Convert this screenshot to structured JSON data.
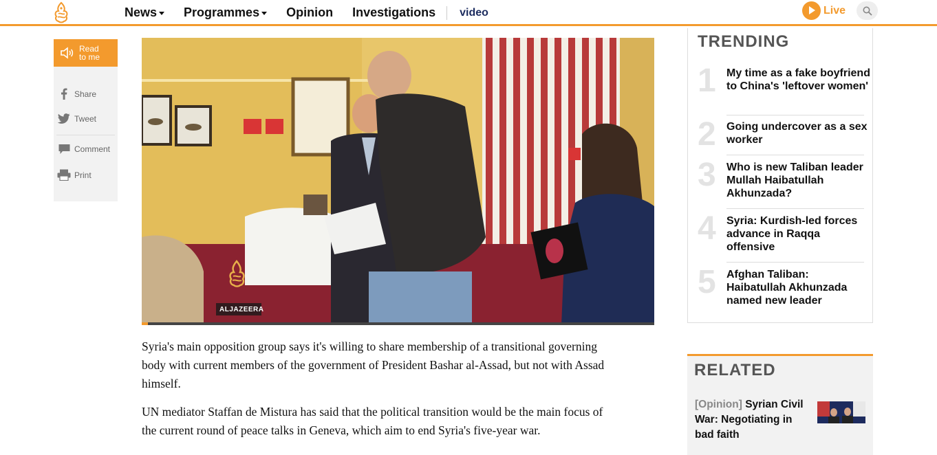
{
  "header": {
    "nav": [
      {
        "label": "News",
        "has_dropdown": true
      },
      {
        "label": "Programmes",
        "has_dropdown": true
      },
      {
        "label": "Opinion",
        "has_dropdown": false
      },
      {
        "label": "Investigations",
        "has_dropdown": false
      }
    ],
    "video_label": "video",
    "live_label": "Live",
    "icons": {
      "logo": "aljazeera-logo-icon",
      "live": "play-icon",
      "search": "search-icon"
    }
  },
  "share": {
    "read_label_line1": "Read",
    "read_label_line2": "to me",
    "items": [
      {
        "label": "Share",
        "icon": "facebook-icon"
      },
      {
        "label": "Tweet",
        "icon": "twitter-icon"
      },
      {
        "label": "Comment",
        "icon": "comment-icon"
      },
      {
        "label": "Print",
        "icon": "print-icon"
      }
    ]
  },
  "video": {
    "watermark": "ALJAZEERA",
    "progress": 0.012
  },
  "article": {
    "paragraphs": [
      "Syria's main opposition group says it's willing to share membership of a transitional governing body with current members of the government of President Bashar al-Assad, but not with Assad himself.",
      "UN mediator Staffan de Mistura has said that the political transition would be the main focus of the current round of peace talks in Geneva, which aim to end Syria's five-year war."
    ]
  },
  "trending": {
    "title": "TRENDING",
    "items": [
      {
        "num": "1",
        "text": "My time as a fake boyfriend to China's 'leftover women'"
      },
      {
        "num": "2",
        "text": "Going undercover as a sex worker"
      },
      {
        "num": "3",
        "text": "Who is new Taliban leader Mullah Haibatullah Akhunzada?"
      },
      {
        "num": "4",
        "text": "Syria: Kurdish-led forces advance in Raqqa offensive"
      },
      {
        "num": "5",
        "text": "Afghan Taliban: Haibatullah Akhunzada named new leader"
      }
    ]
  },
  "related": {
    "title": "RELATED",
    "tag": "[Opinion]",
    "text": "Syrian Civil War: Negotiating in bad faith"
  },
  "colors": {
    "accent": "#f39a2d",
    "video_nav": "#1b2b5e"
  }
}
